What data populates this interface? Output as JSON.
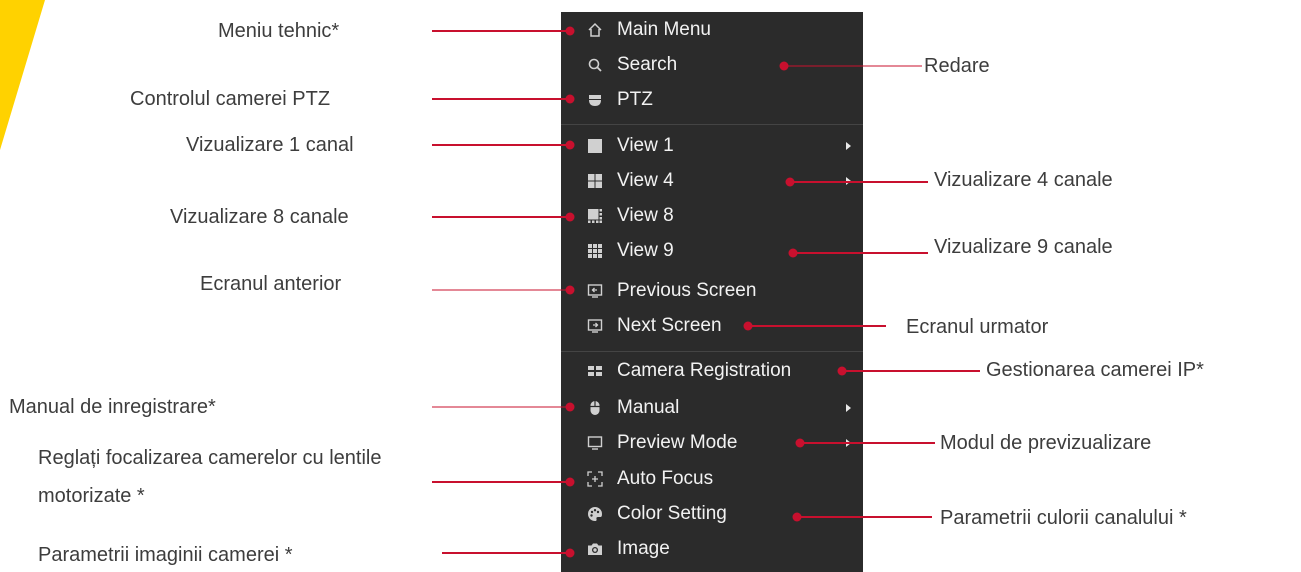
{
  "colors": {
    "accent": "#ffd200",
    "leader": "#c8102e",
    "menu_bg": "#2b2b2b",
    "menu_text": "#f2f2f2",
    "label_text": "#3d3d3d"
  },
  "menu": {
    "items": [
      {
        "label": "Main Menu",
        "icon": "home-icon",
        "submenu": false
      },
      {
        "label": "Search",
        "icon": "search-icon",
        "submenu": false
      },
      {
        "label": "PTZ",
        "icon": "ptz-camera-icon",
        "submenu": false
      },
      {
        "label": "View 1",
        "icon": "view-1-icon",
        "submenu": true
      },
      {
        "label": "View 4",
        "icon": "view-4-icon",
        "submenu": true
      },
      {
        "label": "View 8",
        "icon": "view-8-icon",
        "submenu": false
      },
      {
        "label": "View 9",
        "icon": "view-9-icon",
        "submenu": false
      },
      {
        "label": "Previous Screen",
        "icon": "previous-screen-icon",
        "submenu": false
      },
      {
        "label": "Next Screen",
        "icon": "next-screen-icon",
        "submenu": false
      },
      {
        "label": "Camera Registration",
        "icon": "camera-registration-icon",
        "submenu": false
      },
      {
        "label": "Manual",
        "icon": "mouse-icon",
        "submenu": true
      },
      {
        "label": "Preview Mode",
        "icon": "monitor-icon",
        "submenu": true
      },
      {
        "label": "Auto Focus",
        "icon": "focus-icon",
        "submenu": false
      },
      {
        "label": "Color Setting",
        "icon": "palette-icon",
        "submenu": false
      },
      {
        "label": "Image",
        "icon": "camera-icon",
        "submenu": false
      }
    ]
  },
  "annotations": {
    "left": [
      "Meniu tehnic*",
      "Controlul camerei PTZ",
      "Vizualizare 1 canal",
      "Vizualizare 8 canale",
      "Ecranul anterior",
      "Manual de inregistrare*",
      "Reglați focalizarea camerelor cu lentile motorizate *",
      "Parametrii imaginii camerei *"
    ],
    "right": [
      "Redare",
      "Vizualizare 4 canale",
      "Vizualizare 9 canale",
      "Ecranul urmator",
      "Gestionarea camerei IP*",
      "Modul de previzualizare",
      "Parametrii culorii canalului *"
    ]
  }
}
